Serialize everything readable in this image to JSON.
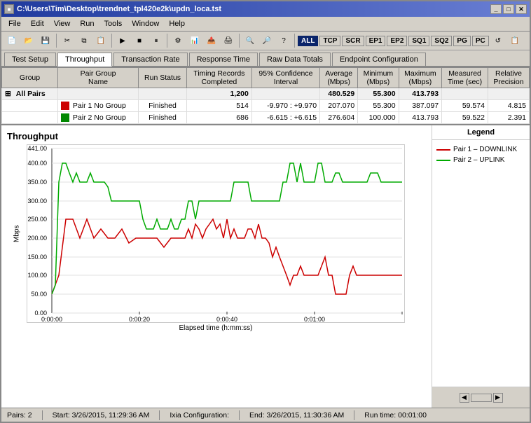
{
  "window": {
    "title": "C:\\Users\\Tim\\Desktop\\trendnet_tpl420e2k\\updn_loca.tst",
    "titleShort": "C:\\Users\\Tim\\Desktop\\trendnet_tpl420e2k\\updn_loca.tst"
  },
  "menu": {
    "items": [
      "File",
      "Edit",
      "View",
      "Run",
      "Tools",
      "Window",
      "Help"
    ]
  },
  "toolbar": {
    "tags": [
      "ALL",
      "TCP",
      "SCR",
      "EP1",
      "EP2",
      "SQ1",
      "SQ2",
      "PG",
      "PC"
    ]
  },
  "tabs": {
    "items": [
      "Test Setup",
      "Throughput",
      "Transaction Rate",
      "Response Time",
      "Raw Data Totals",
      "Endpoint Configuration"
    ],
    "active": "Throughput"
  },
  "table": {
    "headers": [
      "Group",
      "Pair Group Name",
      "Run Status",
      "Timing Records Completed",
      "95% Confidence Interval",
      "Average (Mbps)",
      "Minimum (Mbps)",
      "Maximum (Mbps)",
      "Measured Time (sec)",
      "Relative Precision"
    ],
    "rows": [
      {
        "type": "all",
        "group": "All Pairs",
        "pairName": "",
        "runStatus": "",
        "records": "1,200",
        "confidence": "",
        "average": "480.529",
        "minimum": "55.300",
        "maximum": "413.793",
        "measuredTime": "",
        "precision": ""
      },
      {
        "type": "pair",
        "color": "red",
        "group": "",
        "pairName": "Pair 1  No Group",
        "runStatus": "Finished",
        "records": "514",
        "confidence": "-9.970 : +9.970",
        "average": "207.070",
        "minimum": "55.300",
        "maximum": "387.097",
        "measuredTime": "59.574",
        "precision": "4.815"
      },
      {
        "type": "pair",
        "color": "green",
        "group": "",
        "pairName": "Pair 2  No Group",
        "runStatus": "Finished",
        "records": "686",
        "confidence": "-6.615 : +6.615",
        "average": "276.604",
        "minimum": "100.000",
        "maximum": "413.793",
        "measuredTime": "59.522",
        "precision": "2.391"
      }
    ]
  },
  "chart": {
    "title": "Throughput",
    "yAxisLabel": "Mbps",
    "xAxisLabel": "Elapsed time (h:mm:ss)",
    "yTicks": [
      "441.00",
      "400.00",
      "350.00",
      "300.00",
      "250.00",
      "200.00",
      "150.00",
      "100.00",
      "50.00",
      "0.00"
    ],
    "xTicks": [
      "0:0:00:00",
      "0:0:00:20",
      "0:0:00:40",
      "0:0:01:00"
    ],
    "legend": {
      "title": "Legend",
      "items": [
        {
          "label": "Pair 1 – DOWNLINK",
          "color": "#cc0000"
        },
        {
          "label": "Pair 2 – UPLINK",
          "color": "#00aa00"
        }
      ]
    }
  },
  "statusBar": {
    "pairs": "Pairs: 2",
    "start": "Start: 3/26/2015, 11:29:36 AM",
    "ixiaConfig": "Ixia Configuration:",
    "end": "End: 3/26/2015, 11:30:36 AM",
    "runTime": "Run time: 00:01:00"
  }
}
